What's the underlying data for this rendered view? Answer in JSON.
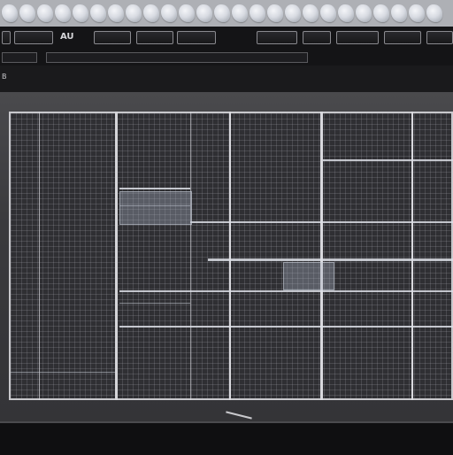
{
  "toolbar": {
    "left_label": "AU",
    "buttons_left": [
      "",
      "",
      ""
    ],
    "buttons_right": [
      "",
      "",
      "",
      "",
      ""
    ]
  },
  "row2": {
    "label": "",
    "field": ""
  },
  "row3": {
    "left_labels": [
      "B",
      ""
    ],
    "right_label": ""
  },
  "status": {
    "left": "",
    "center": ""
  }
}
